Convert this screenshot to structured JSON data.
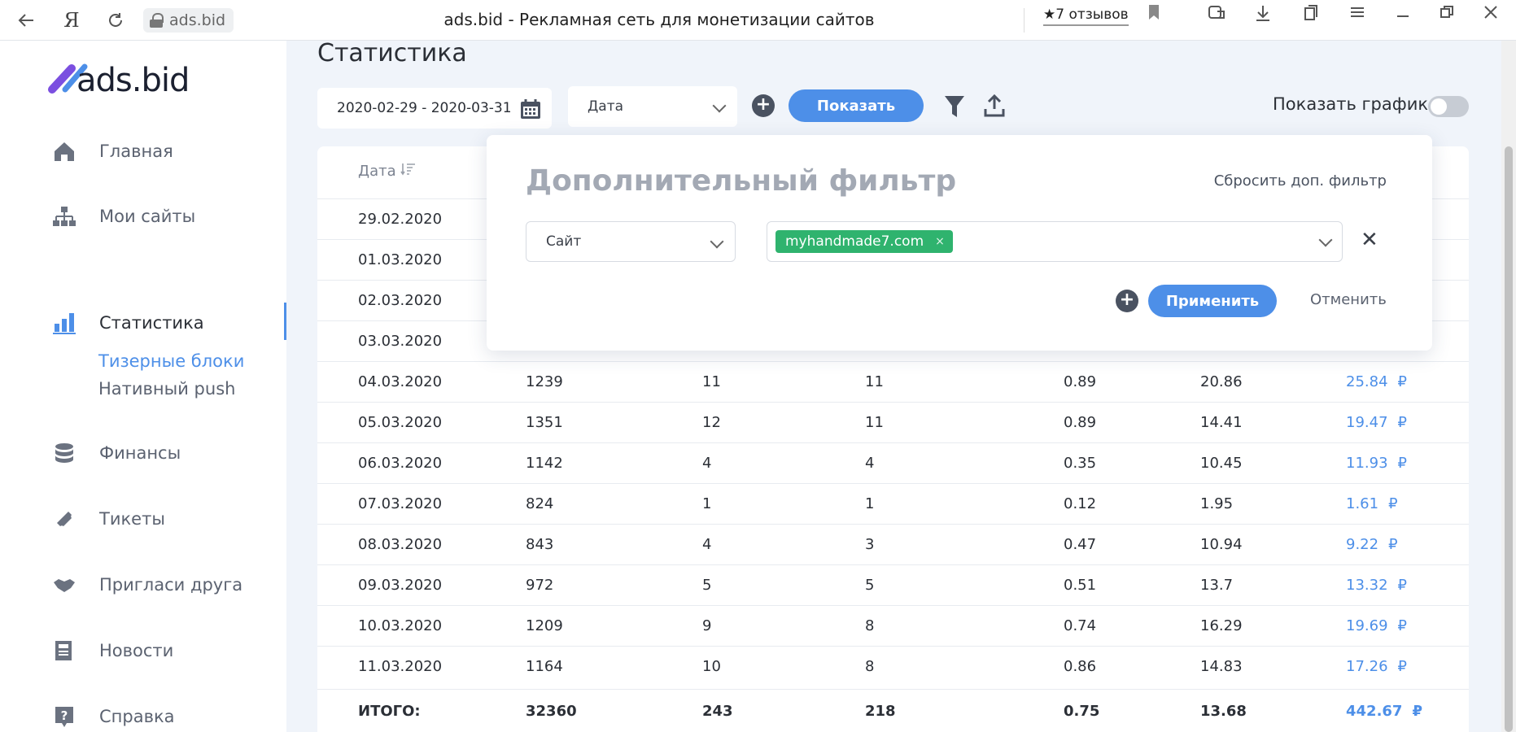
{
  "browser": {
    "back_icon": "arrow-left-icon",
    "yandex_glyph": "Я",
    "reload_icon": "reload-icon",
    "url": "ads.bid",
    "tab_title": "ads.bid - Рекламная сеть для монетизации сайтов",
    "reviews": "★7 отзывов",
    "icons": [
      "bookmark-icon",
      "extensions-icon",
      "download-icon",
      "collections-icon",
      "menu-icon",
      "minimize-icon",
      "restore-icon",
      "close-icon"
    ]
  },
  "sidebar": {
    "logo": "ads.bid",
    "items": [
      {
        "label": "Главная",
        "icon": "home-icon"
      },
      {
        "label": "Мои сайты",
        "icon": "sitemap-icon"
      },
      {
        "label": "Статистика",
        "icon": "bar-chart-icon",
        "active": true
      },
      {
        "label": "Финансы",
        "icon": "coins-icon"
      },
      {
        "label": "Тикеты",
        "icon": "ticket-icon"
      },
      {
        "label": "Пригласи друга",
        "icon": "handshake-icon"
      },
      {
        "label": "Новости",
        "icon": "newspaper-icon"
      },
      {
        "label": "Справка",
        "icon": "help-icon"
      }
    ],
    "sub_items": [
      {
        "label": "Тизерные блоки",
        "active": true
      },
      {
        "label": "Нативный push",
        "active": false
      }
    ]
  },
  "main": {
    "title": "Статистика",
    "date_range": "2020-02-29 - 2020-03-31",
    "group_select": "Дата",
    "show_button": "Показать",
    "show_chart_label": "Показать график",
    "show_chart_enabled": false
  },
  "table": {
    "header_date": "Дата",
    "rows": [
      {
        "date": "29.02.2020"
      },
      {
        "date": "01.03.2020"
      },
      {
        "date": "02.03.2020"
      },
      {
        "date": "03.03.2020"
      },
      {
        "date": "04.03.2020",
        "c1": "1239",
        "c2": "11",
        "c3": "11",
        "c4": "0.89",
        "c5": "20.86",
        "money": "25.84"
      },
      {
        "date": "05.03.2020",
        "c1": "1351",
        "c2": "12",
        "c3": "11",
        "c4": "0.89",
        "c5": "14.41",
        "money": "19.47"
      },
      {
        "date": "06.03.2020",
        "c1": "1142",
        "c2": "4",
        "c3": "4",
        "c4": "0.35",
        "c5": "10.45",
        "money": "11.93"
      },
      {
        "date": "07.03.2020",
        "c1": "824",
        "c2": "1",
        "c3": "1",
        "c4": "0.12",
        "c5": "1.95",
        "money": "1.61"
      },
      {
        "date": "08.03.2020",
        "c1": "843",
        "c2": "4",
        "c3": "3",
        "c4": "0.47",
        "c5": "10.94",
        "money": "9.22"
      },
      {
        "date": "09.03.2020",
        "c1": "972",
        "c2": "5",
        "c3": "5",
        "c4": "0.51",
        "c5": "13.7",
        "money": "13.32"
      },
      {
        "date": "10.03.2020",
        "c1": "1209",
        "c2": "9",
        "c3": "8",
        "c4": "0.74",
        "c5": "16.29",
        "money": "19.69"
      },
      {
        "date": "11.03.2020",
        "c1": "1164",
        "c2": "10",
        "c3": "8",
        "c4": "0.86",
        "c5": "14.83",
        "money": "17.26"
      }
    ],
    "total": {
      "label": "ИТОГО:",
      "c1": "32360",
      "c2": "243",
      "c3": "218",
      "c4": "0.75",
      "c5": "13.68",
      "money": "442.67"
    },
    "currency": "₽"
  },
  "filter_popup": {
    "title": "Дополнительный фильтр",
    "reset": "Сбросить доп. фильтр",
    "field_select": "Сайт",
    "tags": [
      "myhandmade7.com"
    ],
    "tag_remove": "×",
    "apply": "Применить",
    "cancel": "Отменить",
    "close": "✕"
  },
  "colors": {
    "accent": "#4d8fe8",
    "tag": "#2fb36e",
    "sidebar_bg": "#ffffff",
    "page_bg": "#f0f4fa"
  }
}
